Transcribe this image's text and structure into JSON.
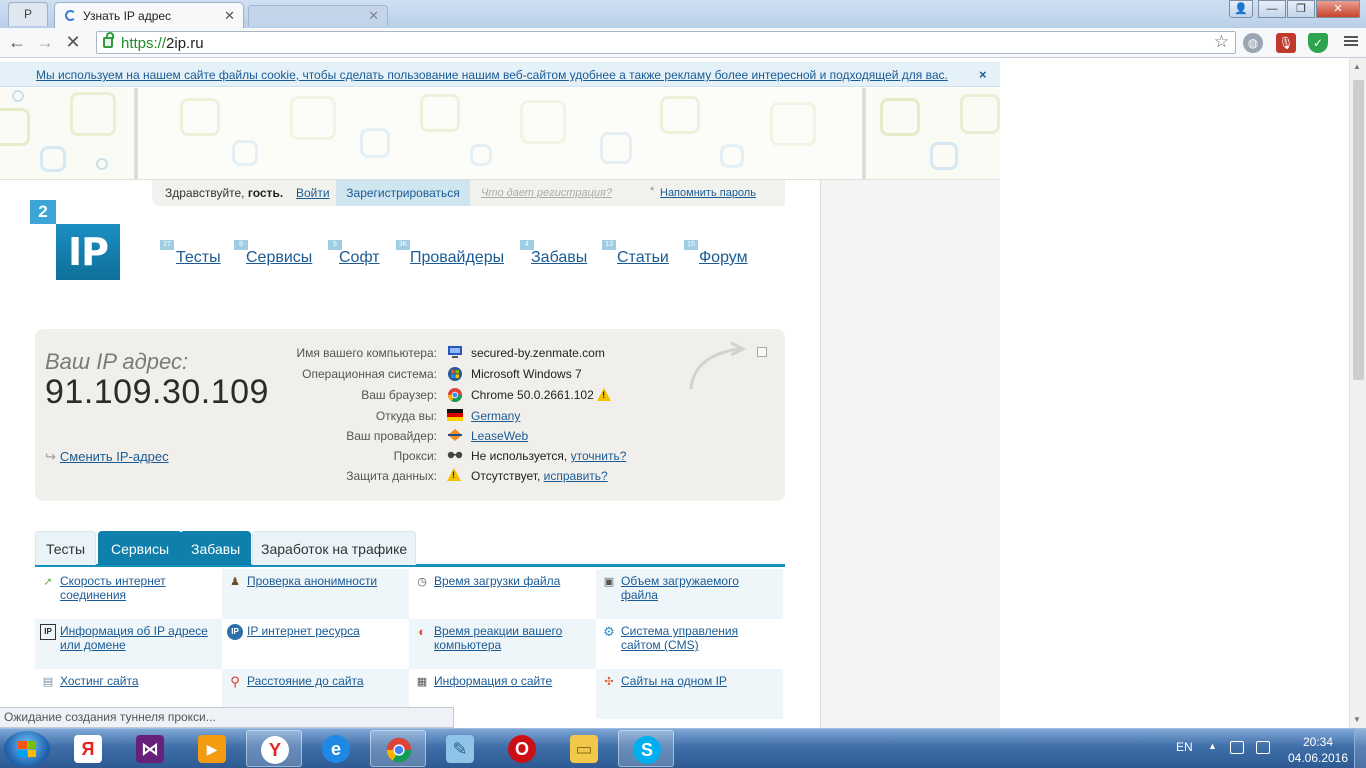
{
  "browser": {
    "profile_tab_label": "P",
    "active_tab_title": "Узнать IP адрес",
    "inactive_tab_title": "",
    "url_scheme": "https://",
    "url_host": "2ip.ru"
  },
  "cookie_notice": {
    "text": "Мы используем на нашем сайте файлы cookie, чтобы сделать пользование нашим веб-сайтом удобнее а также рекламу более интересной и подходящей для вас.",
    "close_label": "×"
  },
  "login": {
    "greeting": "Здравствуйте,",
    "guest": "гость.",
    "login_link": "Войти",
    "register_button": "Зарегистрироваться",
    "what_link": "Что дает регистрация?",
    "remind_link": "Напомнить пароль"
  },
  "logo": {
    "digit": "2",
    "text": "IP"
  },
  "nav": [
    {
      "badge": "27",
      "label": "Тесты"
    },
    {
      "badge": "9",
      "label": "Сервисы"
    },
    {
      "badge": "5",
      "label": "Софт"
    },
    {
      "badge": "3K",
      "label": "Провайдеры"
    },
    {
      "badge": "4",
      "label": "Забавы"
    },
    {
      "badge": "13",
      "label": "Статьи"
    },
    {
      "badge": "15",
      "label": "Форум"
    }
  ],
  "ip_info": {
    "caption": "Ваш IP адрес:",
    "ip": "91.109.30.109",
    "change_link": "Сменить IP-адрес",
    "rows": [
      {
        "label": "Имя вашего компьютера:",
        "value": "secured-by.zenmate.com"
      },
      {
        "label": "Операционная система:",
        "value": "Microsoft Windows 7"
      },
      {
        "label": "Ваш браузер:",
        "value": "Chrome 50.0.2661.102"
      },
      {
        "label": "Откуда вы:",
        "value": "Germany"
      },
      {
        "label": "Ваш провайдер:",
        "value": "LeaseWeb"
      },
      {
        "label": "Прокси:",
        "value": "Не используется,",
        "link": "уточнить?"
      },
      {
        "label": "Защита данных:",
        "value": "Отсутствует,",
        "link": "исправить?"
      }
    ]
  },
  "service_tabs": [
    {
      "label": "Тесты",
      "style": "light"
    },
    {
      "label": "Сервисы",
      "style": "dark"
    },
    {
      "label": "Забавы",
      "style": "dark"
    },
    {
      "label": "Заработок на трафике",
      "style": "light"
    }
  ],
  "services": [
    {
      "label": "Скорость интернет соединения",
      "icon": "speed-icon"
    },
    {
      "label": "Проверка анонимности",
      "icon": "person-icon"
    },
    {
      "label": "Время загрузки файла",
      "icon": "clock-icon"
    },
    {
      "label": "Объем загружаемого файла",
      "icon": "file-size-icon"
    },
    {
      "label": "Информация об IP адресе или домене",
      "icon": "ip-icon"
    },
    {
      "label": "IP интернет ресурса",
      "icon": "ip-circle-icon"
    },
    {
      "label": "Время реакции вашего компьютера",
      "icon": "reaction-icon"
    },
    {
      "label": "Система управления сайтом (CMS)",
      "icon": "cms-icon"
    },
    {
      "label": "Хостинг сайта",
      "icon": "hosting-icon"
    },
    {
      "label": "Расстояние до сайта",
      "icon": "pin-icon"
    },
    {
      "label": "Информация о сайте",
      "icon": "site-info-icon"
    },
    {
      "label": "Сайты на одном IP",
      "icon": "sites-icon"
    }
  ],
  "status_bar": "Ожидание создания туннеля прокси...",
  "taskbar": {
    "apps": [
      "yandex-app",
      "visual-studio-app",
      "video-app",
      "yandex-browser-app",
      "internet-explorer-app",
      "chrome-app",
      "notepad-app",
      "opera-app",
      "file-explorer-app",
      "skype-app"
    ],
    "language": "EN",
    "time": "20:34",
    "date": "04.06.2016"
  },
  "colors": {
    "link": "#1b5b94",
    "accent_tab": "#0f7fab",
    "logo_blue": "#1b8fc2"
  }
}
